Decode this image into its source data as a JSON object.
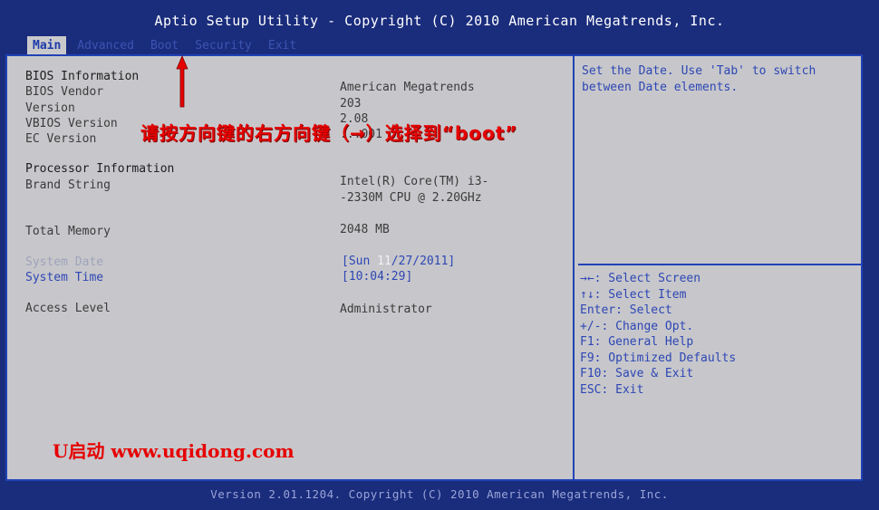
{
  "header": {
    "title": "Aptio Setup Utility - Copyright (C) 2010 American Megatrends, Inc."
  },
  "tabs": [
    {
      "label": "Main",
      "active": true
    },
    {
      "label": "Advanced",
      "active": false
    },
    {
      "label": "Boot",
      "active": false
    },
    {
      "label": "Security",
      "active": false
    },
    {
      "label": "Exit",
      "active": false
    }
  ],
  "main": {
    "bios_section": "BIOS Information",
    "bios_vendor_label": "BIOS Vendor",
    "bios_vendor_value": "American Megatrends",
    "version_label": "Version",
    "version_value": "203",
    "vbios_label": "VBIOS Version",
    "vbios_value": "2.08",
    "ec_label": "EC Version",
    "ec_value": "...001",
    "processor_section": "Processor Information",
    "brand_label": "Brand String",
    "brand_value_1": "Intel(R) Core(TM) i3-",
    "brand_value_2": "-2330M CPU @ 2.20GHz",
    "memory_label": "Total Memory",
    "memory_value": "2048 MB",
    "date_label": "System Date",
    "date_prefix": "[Sun ",
    "date_selected": "11",
    "date_suffix": "/27/2011]",
    "time_label": "System Time",
    "time_value": "[10:04:29]",
    "access_label": "Access Level",
    "access_value": "Administrator"
  },
  "help": {
    "text": "Set the Date. Use 'Tab' to switch between Date elements.",
    "keys": [
      "→←: Select Screen",
      "↑↓: Select Item",
      "Enter: Select",
      "+/-: Change Opt.",
      "F1: General Help",
      "F9: Optimized Defaults",
      "F10: Save & Exit",
      "ESC: Exit"
    ]
  },
  "footer": {
    "text": "Version 2.01.1204. Copyright (C) 2010 American Megatrends, Inc."
  },
  "annotation": {
    "text": "请按方向键的右方向键（→）选择到“boot”"
  },
  "watermark": {
    "text": "U启动 www.uqidong.com"
  },
  "colors": {
    "background": "#1a2c7c",
    "panel": "#c7c7cb",
    "border": "#2142b6",
    "accent_text": "#2d46b4",
    "annotation": "#e60000"
  }
}
